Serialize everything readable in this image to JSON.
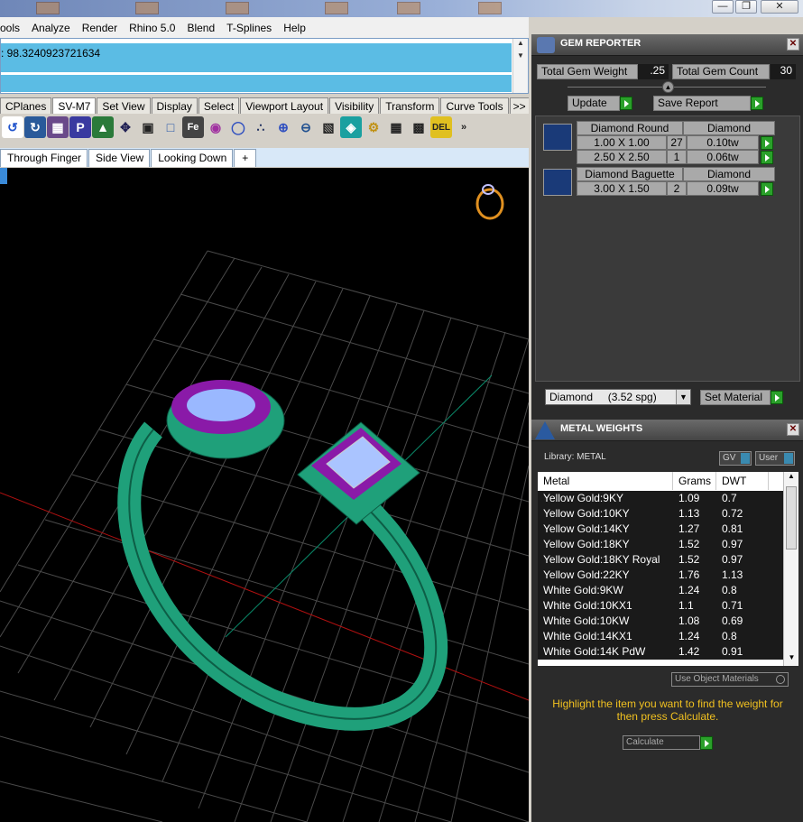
{
  "menu": [
    "ools",
    "Analyze",
    "Render",
    "Rhino 5.0",
    "Blend",
    "T-Splines",
    "Help"
  ],
  "command": {
    "history": ": 98.3240923721634"
  },
  "toolbar_tabs": [
    "CPlanes",
    "SV-M7",
    "Set View",
    "Display",
    "Select",
    "Viewport Layout",
    "Visibility",
    "Transform",
    "Curve Tools"
  ],
  "toolbar_more": ">>",
  "viewport_tabs": [
    "Through Finger",
    "Side View",
    "Looking Down"
  ],
  "viewport_add": "+",
  "gem": {
    "title": "GEM REPORTER",
    "weight_label": "Total Gem Weight",
    "weight_value": ".25",
    "count_label": "Total Gem Count",
    "count_value": "30",
    "update_label": "Update",
    "save_label": "Save Report",
    "groups": [
      {
        "name": "Diamond Round",
        "type": "Diamond",
        "rows": [
          {
            "size": "1.00 X 1.00",
            "count": "27",
            "tw": "0.10tw"
          },
          {
            "size": "2.50 X 2.50",
            "count": "1",
            "tw": "0.06tw"
          }
        ]
      },
      {
        "name": "Diamond Baguette",
        "type": "Diamond",
        "rows": [
          {
            "size": "3.00 X 1.50",
            "count": "2",
            "tw": "0.09tw"
          }
        ]
      }
    ],
    "material_select": "Diamond     (3.52 spg)",
    "set_material_label": "Set Material"
  },
  "metal": {
    "title": "METAL WEIGHTS",
    "library_label": "Library: METAL",
    "gv_label": "GV",
    "user_label": "User",
    "headers": [
      "Metal",
      "Grams",
      "DWT"
    ],
    "rows": [
      [
        "Yellow Gold:9KY",
        "1.09",
        "0.7"
      ],
      [
        "Yellow Gold:10KY",
        "1.13",
        "0.72"
      ],
      [
        "Yellow Gold:14KY",
        "1.27",
        "0.81"
      ],
      [
        "Yellow Gold:18KY",
        "1.52",
        "0.97"
      ],
      [
        "Yellow Gold:18KY Royal",
        "1.52",
        "0.97"
      ],
      [
        "Yellow Gold:22KY",
        "1.76",
        "1.13"
      ],
      [
        "White Gold:9KW",
        "1.24",
        "0.8"
      ],
      [
        "White Gold:10KX1",
        "1.1",
        "0.71"
      ],
      [
        "White Gold:10KW",
        "1.08",
        "0.69"
      ],
      [
        "White Gold:14KX1",
        "1.24",
        "0.8"
      ],
      [
        "White Gold:14K PdW",
        "1.42",
        "0.91"
      ]
    ],
    "use_object_materials": "Use Object Materials",
    "hint": "Highlight the item you want to find the weight for then press Calculate.",
    "calculate_label": "Calculate"
  },
  "colors": {
    "accent_green": "#2aa02a",
    "command_blue": "#5bbce4",
    "ring_green": "#1fa07a",
    "prong_purple": "#8a1aa8",
    "hint_yellow": "#f0c020"
  }
}
